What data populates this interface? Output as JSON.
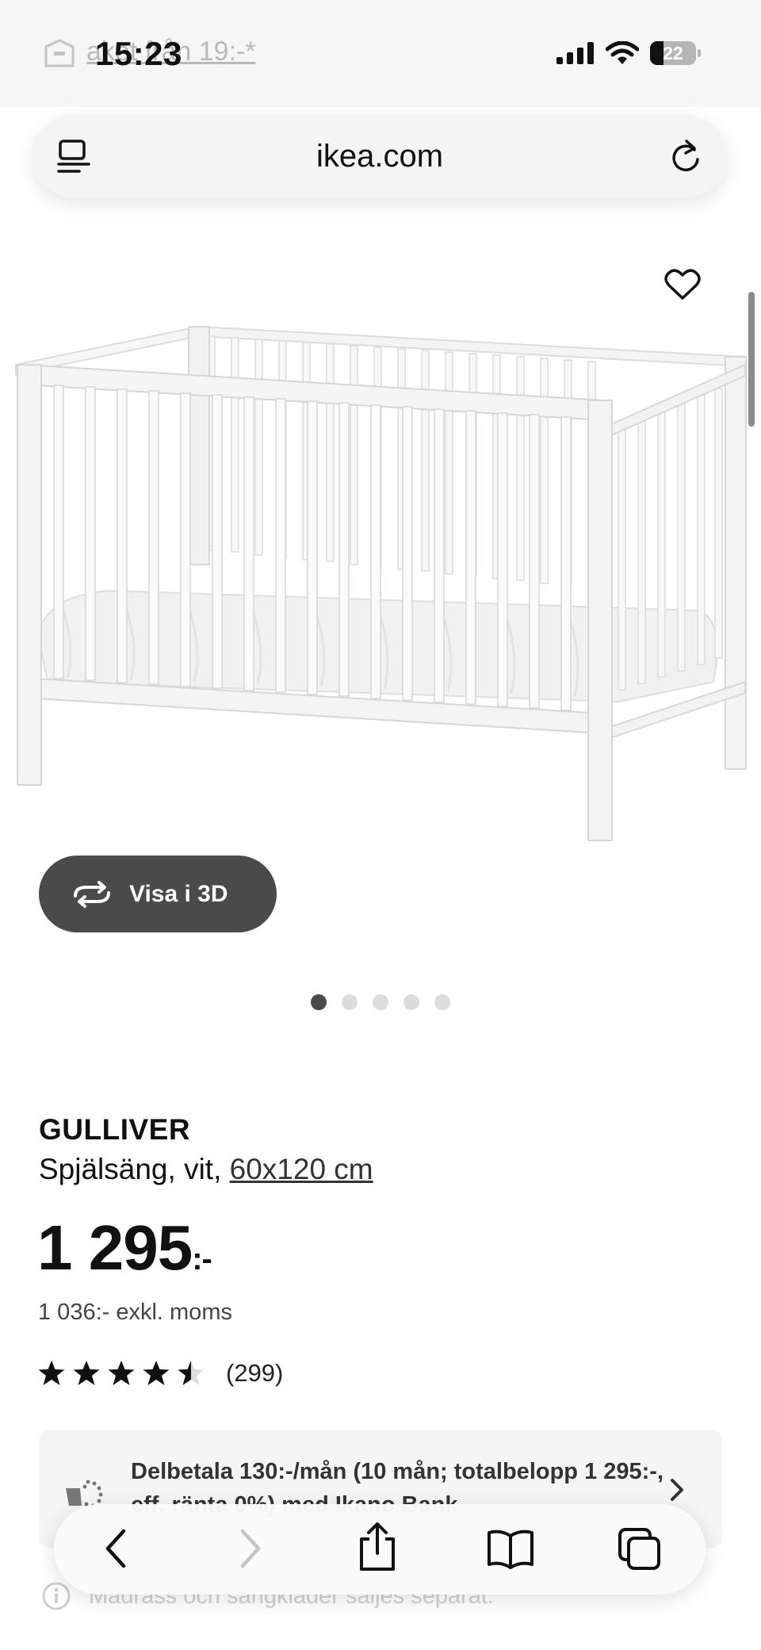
{
  "status_bar": {
    "time": "15:23",
    "battery": "22"
  },
  "promo": {
    "text": "aket från 19:-*"
  },
  "browser": {
    "url": "ikea.com"
  },
  "gallery": {
    "view_3d_label": "Visa i 3D",
    "slide_count": 5,
    "active_slide": 1
  },
  "product": {
    "name": "GULLIVER",
    "description": "Spjälsäng, vit, ",
    "size": "60x120 cm",
    "price": "1 295",
    "price_suffix": ":-",
    "price_ex_vat": "1 036:- exkl. moms",
    "rating_count": "(299)",
    "rating_value": 4.5
  },
  "installment": {
    "text": "Delbetala 130:-/mån (10 mån; totalbelopp 1 295:-, eff. ränta 0%) med Ikano Bank"
  },
  "notice": {
    "text": "Madrass och sängkläder säljes separat."
  },
  "icons": [
    "delivery-truck-icon",
    "signal-icon",
    "wifi-icon",
    "battery-icon",
    "reader-icon",
    "reload-icon",
    "heart-icon",
    "rotate-3d-icon",
    "star-icon",
    "cart-icon",
    "chevron-right-icon",
    "info-icon",
    "back-icon",
    "forward-icon",
    "share-icon",
    "bookmarks-icon",
    "tabs-icon"
  ],
  "colors": {
    "button_dark": "#4a4a4a",
    "text": "#111111",
    "panel": "#f5f5f5"
  }
}
